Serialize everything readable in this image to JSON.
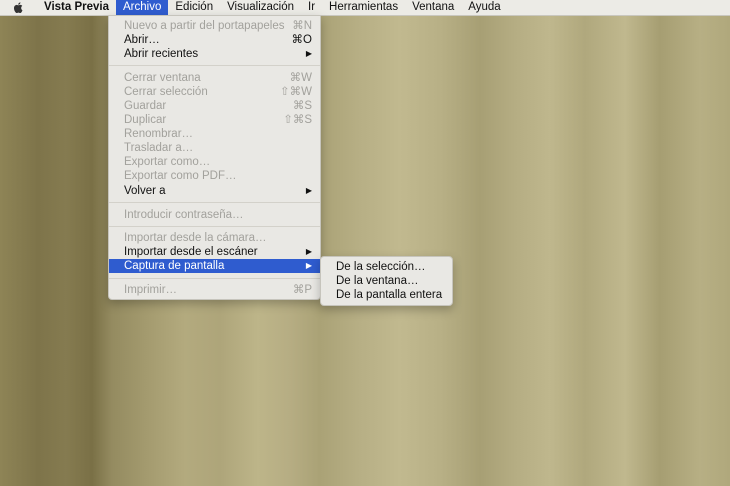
{
  "menubar": {
    "items": [
      "Vista Previa",
      "Archivo",
      "Edición",
      "Visualización",
      "Ir",
      "Herramientas",
      "Ventana",
      "Ayuda"
    ]
  },
  "archivo_menu": {
    "items": [
      {
        "label": "Nuevo a partir del portapapeles",
        "shortcut": "⌘N",
        "enabled": false
      },
      {
        "label": "Abrir…",
        "shortcut": "⌘O",
        "enabled": true
      },
      {
        "label": "Abrir recientes",
        "shortcut": "",
        "enabled": true,
        "submenu": true
      },
      {
        "label": "Cerrar ventana",
        "shortcut": "⌘W",
        "enabled": false
      },
      {
        "label": "Cerrar selección",
        "shortcut": "⇧⌘W",
        "enabled": false
      },
      {
        "label": "Guardar",
        "shortcut": "⌘S",
        "enabled": false
      },
      {
        "label": "Duplicar",
        "shortcut": "⇧⌘S",
        "enabled": false
      },
      {
        "label": "Renombrar…",
        "shortcut": "",
        "enabled": false
      },
      {
        "label": "Trasladar a…",
        "shortcut": "",
        "enabled": false
      },
      {
        "label": "Exportar como…",
        "shortcut": "",
        "enabled": false
      },
      {
        "label": "Exportar como PDF…",
        "shortcut": "",
        "enabled": false
      },
      {
        "label": "Volver a",
        "shortcut": "",
        "enabled": true,
        "submenu": true
      },
      {
        "label": "Introducir contraseña…",
        "shortcut": "",
        "enabled": false
      },
      {
        "label": "Importar desde la cámara…",
        "shortcut": "",
        "enabled": false
      },
      {
        "label": "Importar desde el escáner",
        "shortcut": "",
        "enabled": true,
        "submenu": true
      },
      {
        "label": "Captura de pantalla",
        "shortcut": "",
        "enabled": true,
        "submenu": true,
        "highlighted": true
      },
      {
        "label": "Imprimir…",
        "shortcut": "⌘P",
        "enabled": false
      }
    ]
  },
  "capture_submenu": {
    "items": [
      "De la selección…",
      "De la ventana…",
      "De la pantalla entera"
    ]
  },
  "icons": {
    "apple": "apple-logo-icon",
    "submenu_arrow": "submenu-arrow-icon"
  },
  "colors": {
    "highlight": "#2f5ccf",
    "menu_bg": "#e9e8e4",
    "disabled_text": "#a2a19c"
  }
}
